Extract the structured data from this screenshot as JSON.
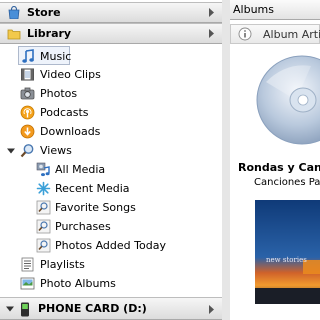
{
  "sidebar": {
    "store_label": "Store",
    "library_label": "Library",
    "items": {
      "music": "Music",
      "video_clips": "Video Clips",
      "photos": "Photos",
      "podcasts": "Podcasts",
      "downloads": "Downloads",
      "views": "Views",
      "all_media": "All Media",
      "recent_media": "Recent Media",
      "favorite_songs": "Favorite Songs",
      "purchases": "Purchases",
      "photos_added_today": "Photos Added Today",
      "playlists": "Playlists",
      "photo_albums": "Photo Albums"
    },
    "device_label": "PHONE CARD (D:)"
  },
  "main": {
    "view_label": "Albums",
    "info_label": "Album Artist",
    "album_title": "Rondas y Canc",
    "album_subtitle": "Canciones Par",
    "cover_text": "new stories"
  },
  "colors": {
    "accent": "#3a6fb0",
    "selected_bg": "#eef3fb"
  }
}
